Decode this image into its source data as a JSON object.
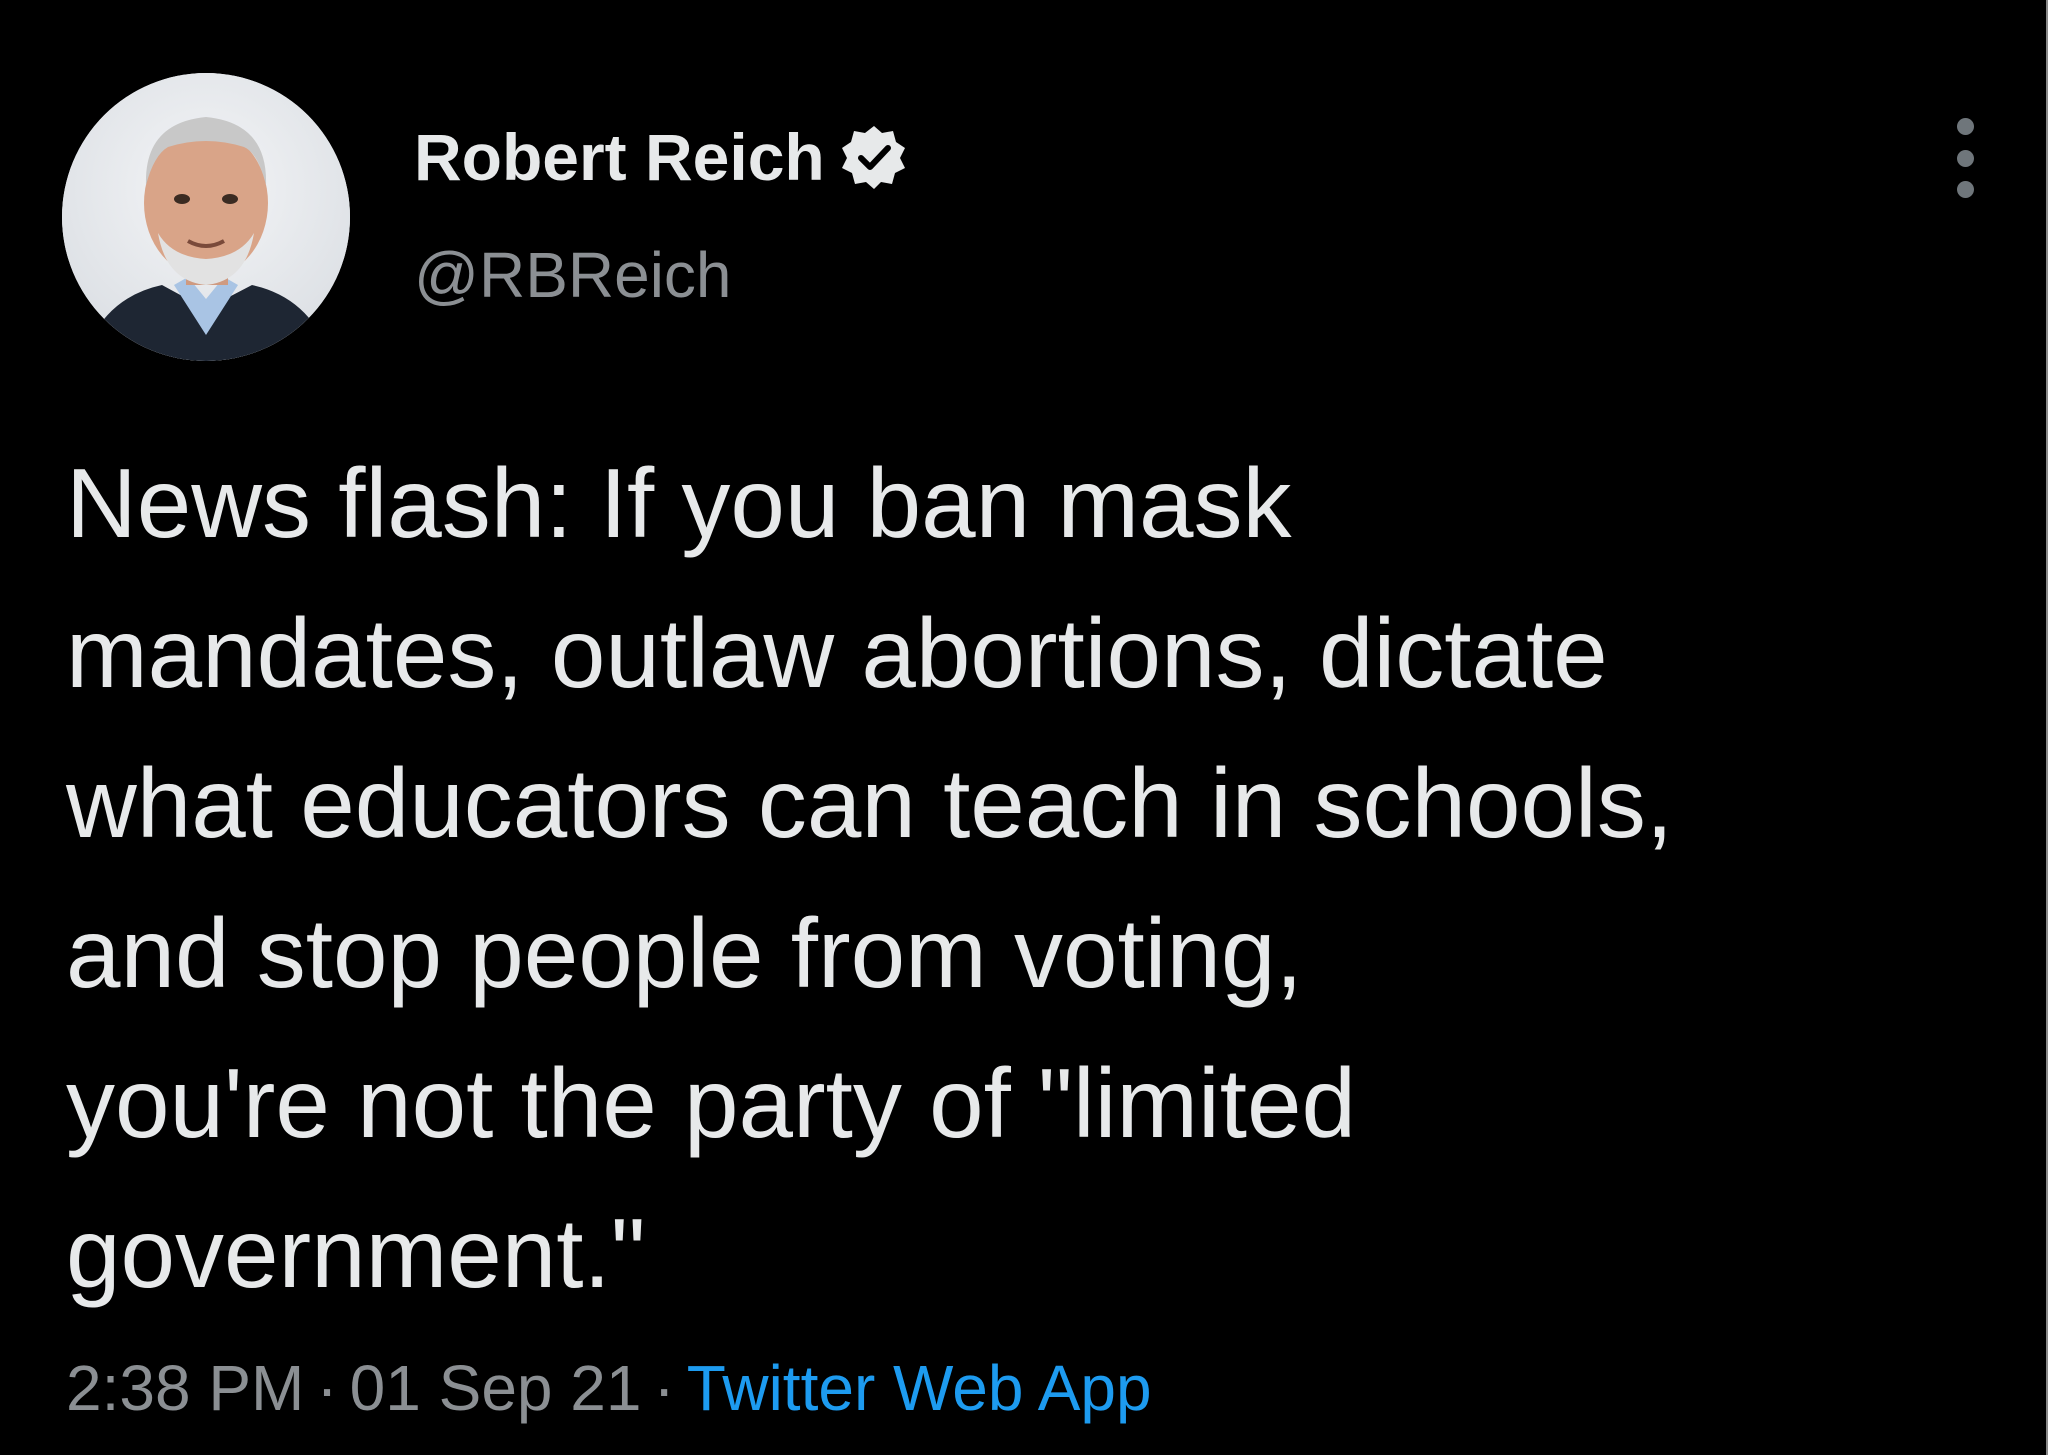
{
  "author": {
    "name": "Robert Reich",
    "handle": "@RBReich",
    "verified": true,
    "avatar_icon": "profile-photo"
  },
  "tweet": {
    "lines": [
      "News flash: If you ban mask",
      "mandates, outlaw abortions, dictate",
      "what educators can teach in schools,",
      "and stop people from voting,",
      "you're not the party of \"limited",
      "government.\""
    ]
  },
  "meta": {
    "time": "2:38 PM",
    "separator": "·",
    "date": "01 Sep 21",
    "source": "Twitter Web App"
  },
  "colors": {
    "background": "#000000",
    "text": "#e7e9ea",
    "secondary": "#8b8f93",
    "link": "#1d9bf0"
  },
  "icons": {
    "verified": "verified-badge-icon",
    "more": "more-options-icon"
  }
}
